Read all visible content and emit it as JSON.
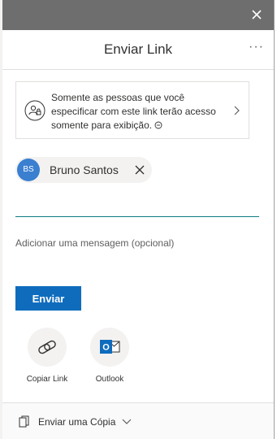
{
  "dialog": {
    "title": "Enviar Link",
    "more_label": "···"
  },
  "permission": {
    "text": "Somente as pessoas que você especificar com este link terão acesso somente para exibição.",
    "icon": "people-lock-icon"
  },
  "recipient": {
    "initials": "BS",
    "name": "Bruno Santos",
    "avatar_color": "#3a7fd0"
  },
  "message": {
    "placeholder": "Adicionar uma mensagem (opcional)"
  },
  "send": {
    "label": "Enviar",
    "color": "#0f6cbd"
  },
  "share_options": [
    {
      "label": "Copiar Link",
      "icon": "link-icon"
    },
    {
      "label": "Outlook",
      "icon": "outlook-icon"
    }
  ],
  "footer": {
    "copy_label": "Enviar uma Cópia",
    "icon": "copy-icon"
  },
  "colors": {
    "titlebar": "#6e6e6e",
    "underline": "#0f7b83",
    "outlook_brand": "#0f6cbd"
  }
}
